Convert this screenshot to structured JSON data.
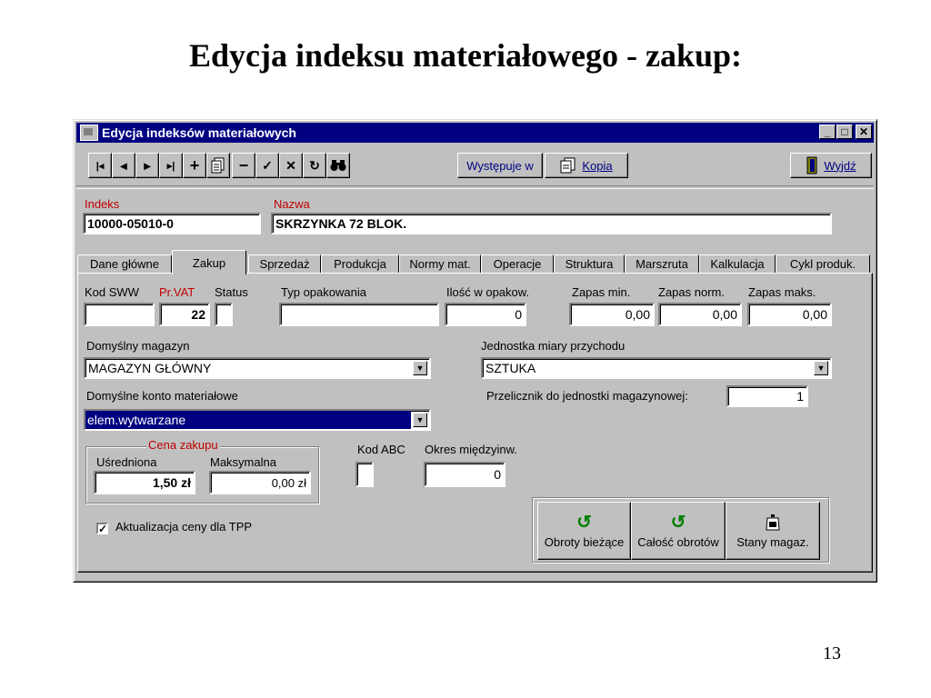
{
  "slide": {
    "title": "Edycja indeksu materiałowego - zakup:",
    "page_number": "13"
  },
  "window": {
    "title": "Edycja indeksów materiałowych"
  },
  "toolbar": {
    "first": "|◂",
    "prev": "◂",
    "next": "▸",
    "last": "▸|",
    "add": "+",
    "delete": "−",
    "confirm": "✓",
    "cancel": "✕",
    "refresh": "↻",
    "wystepuje_label": "Występuje w",
    "kopia_label": "Kopia",
    "wyjdz_label": "Wyjdź"
  },
  "indeks": {
    "label": "Indeks",
    "value": "10000-05010-0"
  },
  "nazwa": {
    "label": "Nazwa",
    "value": "SKRZYNKA 72 BLOK."
  },
  "tabs": [
    {
      "label": "Dane główne"
    },
    {
      "label": "Zakup"
    },
    {
      "label": "Sprzedaż"
    },
    {
      "label": "Produkcja"
    },
    {
      "label": "Normy mat."
    },
    {
      "label": "Operacje"
    },
    {
      "label": "Struktura"
    },
    {
      "label": "Marszruta"
    },
    {
      "label": "Kalkulacja"
    },
    {
      "label": "Cykl produk."
    }
  ],
  "zakup": {
    "kod_sww": {
      "label": "Kod SWW",
      "value": ""
    },
    "pr_vat": {
      "label": "Pr.VAT",
      "value": "22"
    },
    "status": {
      "label": "Status",
      "value": ""
    },
    "typ_opakowania": {
      "label": "Typ opakowania",
      "value": ""
    },
    "ilosc_w_opakow": {
      "label": "Ilość w opakow.",
      "value": "0"
    },
    "zapas_min": {
      "label": "Zapas min.",
      "value": "0,00"
    },
    "zapas_norm": {
      "label": "Zapas norm.",
      "value": "0,00"
    },
    "zapas_maks": {
      "label": "Zapas maks.",
      "value": "0,00"
    },
    "domyslny_magazyn": {
      "label": "Domyślny magazyn",
      "value": "MAGAZYN GŁÓWNY"
    },
    "jednostka": {
      "label": "Jednostka miary przychodu",
      "value": "SZTUKA"
    },
    "konto": {
      "label": "Domyślne konto materiałowe",
      "value": "elem.wytwarzane"
    },
    "przelicznik": {
      "label": "Przelicznik do jednostki magazynowej:",
      "value": "1"
    },
    "cena_zakupu": {
      "title": "Cena zakupu",
      "usredniona_label": "Uśredniona",
      "usredniona_value": "1,50 zł",
      "maksymalna_label": "Maksymalna",
      "maksymalna_value": "0,00 zł"
    },
    "kod_abc": {
      "label": "Kod ABC",
      "value": ""
    },
    "okres": {
      "label": "Okres międzyinw.",
      "value": "0"
    },
    "aktualizacja": {
      "label": "Aktualizacja ceny dla TPP",
      "checked": "✓"
    },
    "buttons": {
      "obroty": "Obroty bieżące",
      "calosc": "Całość obrotów",
      "stany": "Stany magaz."
    }
  }
}
